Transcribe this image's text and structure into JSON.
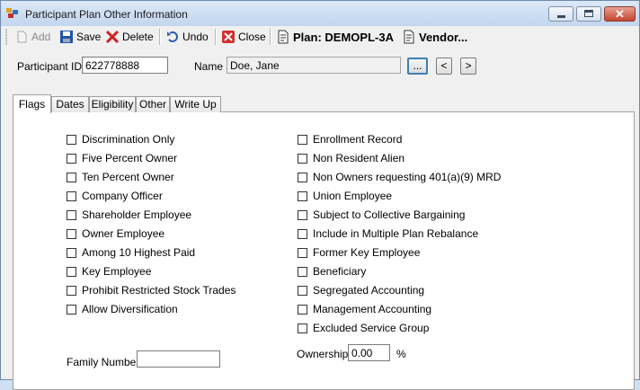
{
  "window": {
    "title": "Participant Plan Other Information"
  },
  "toolbar": {
    "add": "Add",
    "save": "Save",
    "delete": "Delete",
    "undo": "Undo",
    "close": "Close",
    "plan": "Plan: DEMOPL-3A",
    "vendor": "Vendor..."
  },
  "participant": {
    "id_label": "Participant ID",
    "id_value": "622778888",
    "name_label": "Name",
    "name_value": "Doe, Jane",
    "lookup_label": "...",
    "prev_label": "<",
    "next_label": ">"
  },
  "tabs": [
    "Flags",
    "Dates",
    "Eligibility",
    "Other",
    "Write Up"
  ],
  "flags_left": [
    "Discrimination Only",
    "Five Percent Owner",
    "Ten Percent Owner",
    "Company Officer",
    "Shareholder Employee",
    "Owner Employee",
    "Among 10 Highest Paid",
    "Key Employee",
    "Prohibit Restricted Stock Trades",
    "Allow Diversification"
  ],
  "flags_right": [
    "Enrollment Record",
    "Non Resident Alien",
    "Non Owners requesting 401(a)(9) MRD",
    "Union Employee",
    "Subject to Collective Bargaining",
    "Include in Multiple Plan Rebalance",
    "Former Key Employee",
    "Beneficiary",
    "Segregated Accounting",
    "Management Accounting",
    "Excluded Service Group"
  ],
  "family": {
    "label": "Family Number",
    "value": ""
  },
  "ownership": {
    "label": "Ownership",
    "value": "0.00",
    "unit": "%"
  },
  "colors": {
    "accent": "#3c7fb1",
    "close_button": "#c4452f"
  }
}
